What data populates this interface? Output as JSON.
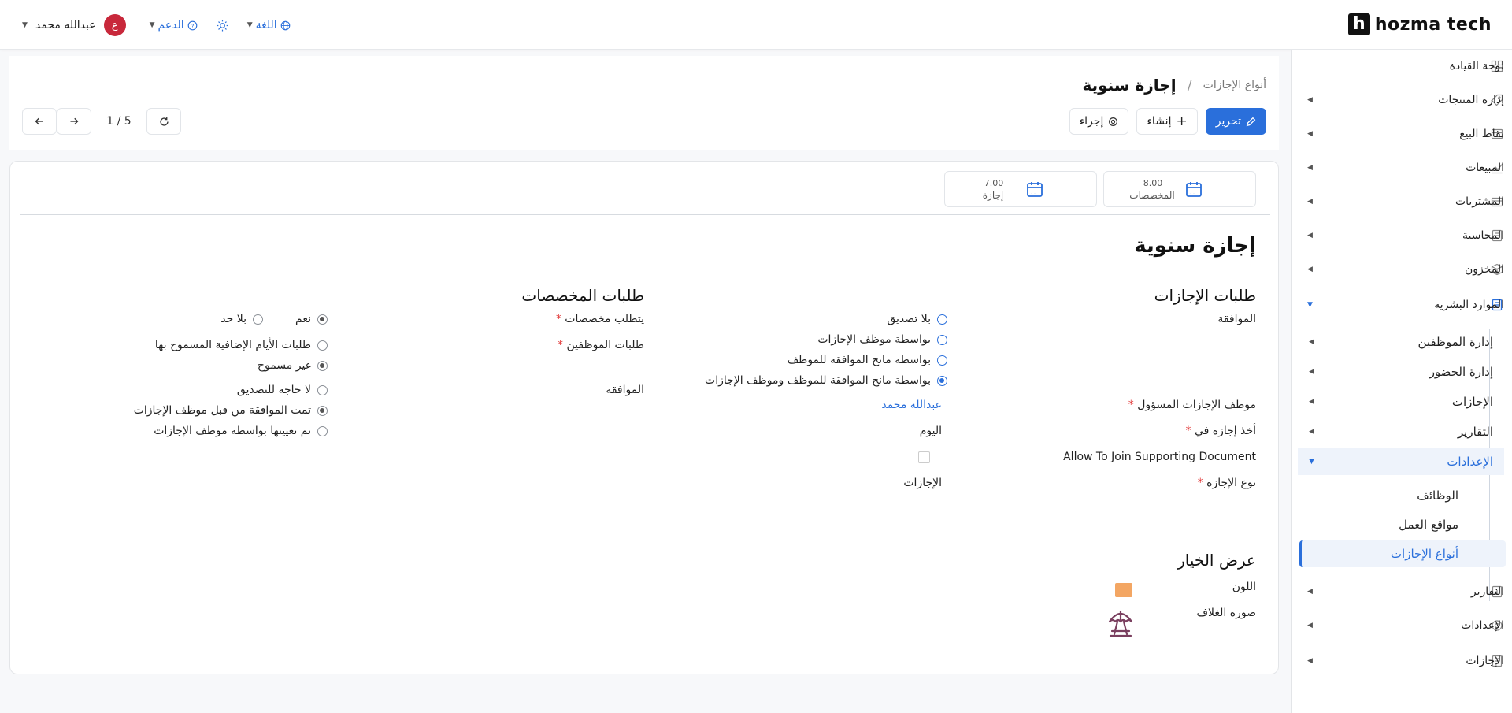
{
  "brand": {
    "mark": "h",
    "name": "hozma tech"
  },
  "topnav": {
    "language": "اللغة",
    "support": "الدعم",
    "user_name": "عبدالله محمد",
    "user_initial": "ع"
  },
  "sidebar": {
    "items": [
      {
        "label": "لوحة القيادة"
      },
      {
        "label": "إدارة المنتجات"
      },
      {
        "label": "نقاط البيع"
      },
      {
        "label": "المبيعات"
      },
      {
        "label": "المشتريات"
      },
      {
        "label": "المحاسبة"
      },
      {
        "label": "المخزون"
      },
      {
        "label": "الموارد البشرية"
      }
    ],
    "hr_sub": [
      {
        "label": "إدارة الموظفين"
      },
      {
        "label": "إدارة الحضور"
      },
      {
        "label": "الإجازات"
      },
      {
        "label": "التقارير"
      },
      {
        "label": "الإعدادات"
      }
    ],
    "settings_sub": [
      {
        "label": "الوظائف"
      },
      {
        "label": "مواقع العمل"
      },
      {
        "label": "أنواع الإجازات"
      }
    ],
    "bottom_items": [
      {
        "label": "التقارير"
      },
      {
        "label": "الإعدادات"
      },
      {
        "label": "الإجازات"
      }
    ]
  },
  "breadcrumb": {
    "parent": "أنواع الإجازات",
    "separator": "/",
    "current": "إجازة سنوية"
  },
  "actions": {
    "edit": "تحرير",
    "create": "إنشاء",
    "action": "إجراء"
  },
  "pager": {
    "count": "1 / 5"
  },
  "stats": [
    {
      "value": "8.00",
      "label": "المخصصات"
    },
    {
      "value": "7.00",
      "label": "إجازة"
    }
  ],
  "record": {
    "title": "إجازة سنوية",
    "leave_requests": {
      "heading": "طلبات الإجازات",
      "approval_label": "الموافقة",
      "approval_options": [
        {
          "label": "بلا تصديق",
          "selected": false
        },
        {
          "label": "بواسطة موظف الإجازات",
          "selected": false
        },
        {
          "label": "بواسطة مانح الموافقة للموظف",
          "selected": false
        },
        {
          "label": "بواسطة مانح الموافقة للموظف وموظف الإجازات",
          "selected": true
        }
      ],
      "officer_label": "موظف الإجازات المسؤول",
      "officer_value": "عبدالله محمد",
      "take_in_label": "أخذ إجازة في",
      "take_in_value": "اليوم",
      "supporting_doc_label": "Allow To Join Supporting Document",
      "supporting_doc_checked": false,
      "kind_label": "نوع الإجازة",
      "kind_value": "الإجازات"
    },
    "allocation_requests": {
      "heading": "طلبات المخصصات",
      "requires_label": "يتطلب مخصصات",
      "requires_options": [
        {
          "label": "نعم",
          "selected": true
        },
        {
          "label": "بلا حد",
          "selected": false
        }
      ],
      "employee_requests_label": "طلبات الموظفين",
      "employee_requests_options": [
        {
          "label": "طلبات الأيام الإضافية المسموح بها",
          "selected": false
        },
        {
          "label": "غير مسموح",
          "selected": true
        }
      ],
      "approval_label": "الموافقة",
      "approval_options": [
        {
          "label": "لا حاجة للتصديق",
          "selected": false
        },
        {
          "label": "تمت الموافقة من قبل موظف الإجازات",
          "selected": true
        },
        {
          "label": "تم تعيينها بواسطة موظف الإجازات",
          "selected": false
        }
      ]
    },
    "display": {
      "heading": "عرض الخيار",
      "color_label": "اللون",
      "color_value": "#f3a663",
      "cover_label": "صورة الغلاف",
      "cover_icon": "beach-umbrella-icon"
    }
  },
  "colors": {
    "accent": "#2a6fdb",
    "avatar": "#c8283b",
    "cover_icon": "#7a3f5f"
  }
}
